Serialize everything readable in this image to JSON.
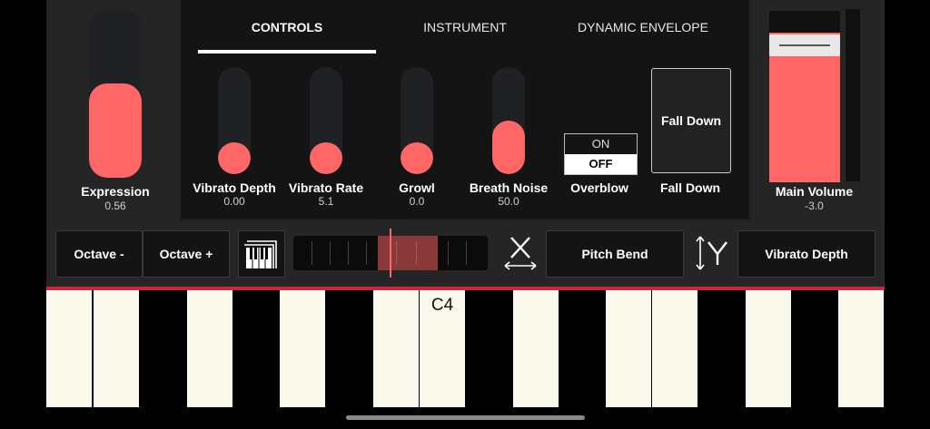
{
  "tabs": [
    {
      "label": "CONTROLS",
      "active": true
    },
    {
      "label": "INSTRUMENT",
      "active": false
    },
    {
      "label": "DYNAMIC ENVELOPE",
      "active": false
    }
  ],
  "expression": {
    "label": "Expression",
    "value": "0.56",
    "level": 0.56
  },
  "sliders": [
    {
      "label": "Vibrato Depth",
      "value": "0.00",
      "level": 0.0
    },
    {
      "label": "Vibrato Rate",
      "value": "5.1",
      "level": 0.1
    },
    {
      "label": "Growl",
      "value": "0.0",
      "level": 0.0
    },
    {
      "label": "Breath Noise",
      "value": "50.0",
      "level": 0.5
    }
  ],
  "overblow": {
    "label": "Overblow",
    "on_label": "ON",
    "off_label": "OFF",
    "selected": "OFF"
  },
  "fall_down": {
    "button_label": "Fall Down",
    "label": "Fall Down"
  },
  "main_volume": {
    "label": "Main Volume",
    "value": "-3.0"
  },
  "controls": {
    "octave_minus": "Octave -",
    "octave_plus": "Octave +",
    "x_axis_assignment": "Pitch Bend",
    "y_axis_assignment": "Vibrato Depth"
  },
  "keyboard": {
    "c4_label": "C4"
  },
  "colors": {
    "accent": "#ff6766",
    "divider": "#d2233c"
  }
}
